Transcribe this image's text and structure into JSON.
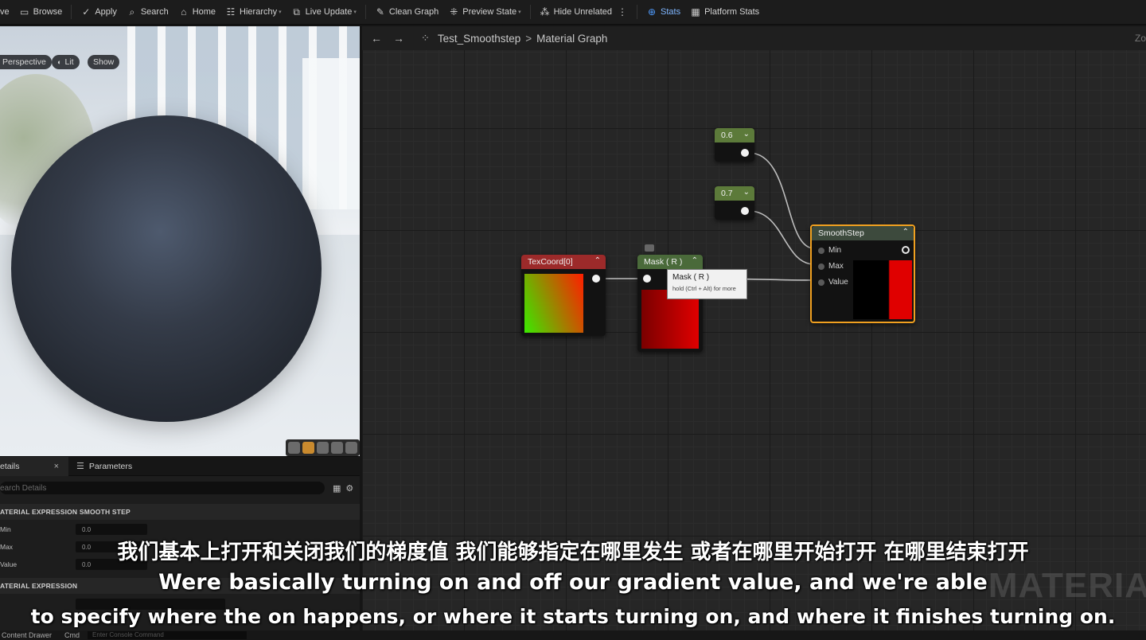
{
  "toolbar": {
    "items": [
      {
        "label": "ve",
        "icon": "save-icon"
      },
      {
        "label": "Browse",
        "icon": "folder-icon"
      },
      {
        "label": "Apply",
        "icon": "apply-icon"
      },
      {
        "label": "Search",
        "icon": "search-icon"
      },
      {
        "label": "Home",
        "icon": "home-icon"
      },
      {
        "label": "Hierarchy",
        "icon": "hierarchy-icon"
      },
      {
        "label": "Live Update",
        "icon": "live-update-icon"
      },
      {
        "label": "Clean Graph",
        "icon": "clean-graph-icon"
      },
      {
        "label": "Preview State",
        "icon": "preview-state-icon"
      },
      {
        "label": "Hide Unrelated",
        "icon": "hide-unrelated-icon"
      },
      {
        "label": "Stats",
        "icon": "stats-icon"
      },
      {
        "label": "Platform Stats",
        "icon": "platform-stats-icon"
      }
    ]
  },
  "viewport": {
    "perspective": "Perspective",
    "lit": "Lit",
    "show": "Show"
  },
  "details": {
    "tab_details": "etails",
    "tab_parameters": "Parameters",
    "search_placeholder": "earch Details",
    "section_smoothstep": "ATERIAL EXPRESSION SMOOTH STEP",
    "section_expression": "ATERIAL EXPRESSION",
    "props": [
      {
        "label": "Min",
        "value": "0.0"
      },
      {
        "label": "Max",
        "value": "0.0"
      },
      {
        "label": "Value",
        "value": "0.0"
      }
    ]
  },
  "graph": {
    "breadcrumb_asset": "Test_Smoothstep",
    "breadcrumb_sep": ">",
    "breadcrumb_graph": "Material Graph",
    "zoom": "Zo",
    "watermark": "MATERIA",
    "nodes": {
      "const1": {
        "value": "0.6"
      },
      "const2": {
        "value": "0.7"
      },
      "texcoord": {
        "title": "TexCoord[0]"
      },
      "mask": {
        "title": "Mask ( R )"
      },
      "smoothstep": {
        "title": "SmoothStep",
        "pin_min": "Min",
        "pin_max": "Max",
        "pin_value": "Value"
      }
    },
    "tooltip": {
      "title": "Mask ( R )",
      "hint": "hold (Ctrl + Alt) for more"
    }
  },
  "bottom": {
    "content_drawer": "Content Drawer",
    "cmd": "Cmd",
    "console_placeholder": "Enter Console Command"
  },
  "subtitles": {
    "zh": "我们基本上打开和关闭我们的梯度值 我们能够指定在哪里发生 或者在哪里开始打开 在哪里结束打开",
    "en_line1": "Were basically turning on and off our gradient value, and we're able",
    "en_line2": "to specify where the on happens, or where it starts turning on, and where it finishes turning on."
  },
  "colors": {
    "constant_header": "#5c7a3a",
    "texcoord_header": "#9c2a2a",
    "mask_header": "#4a6a3a",
    "smoothstep_header": "#3d4a3d",
    "selected_outline": "#f0a020",
    "accent": "#4f9cff"
  }
}
